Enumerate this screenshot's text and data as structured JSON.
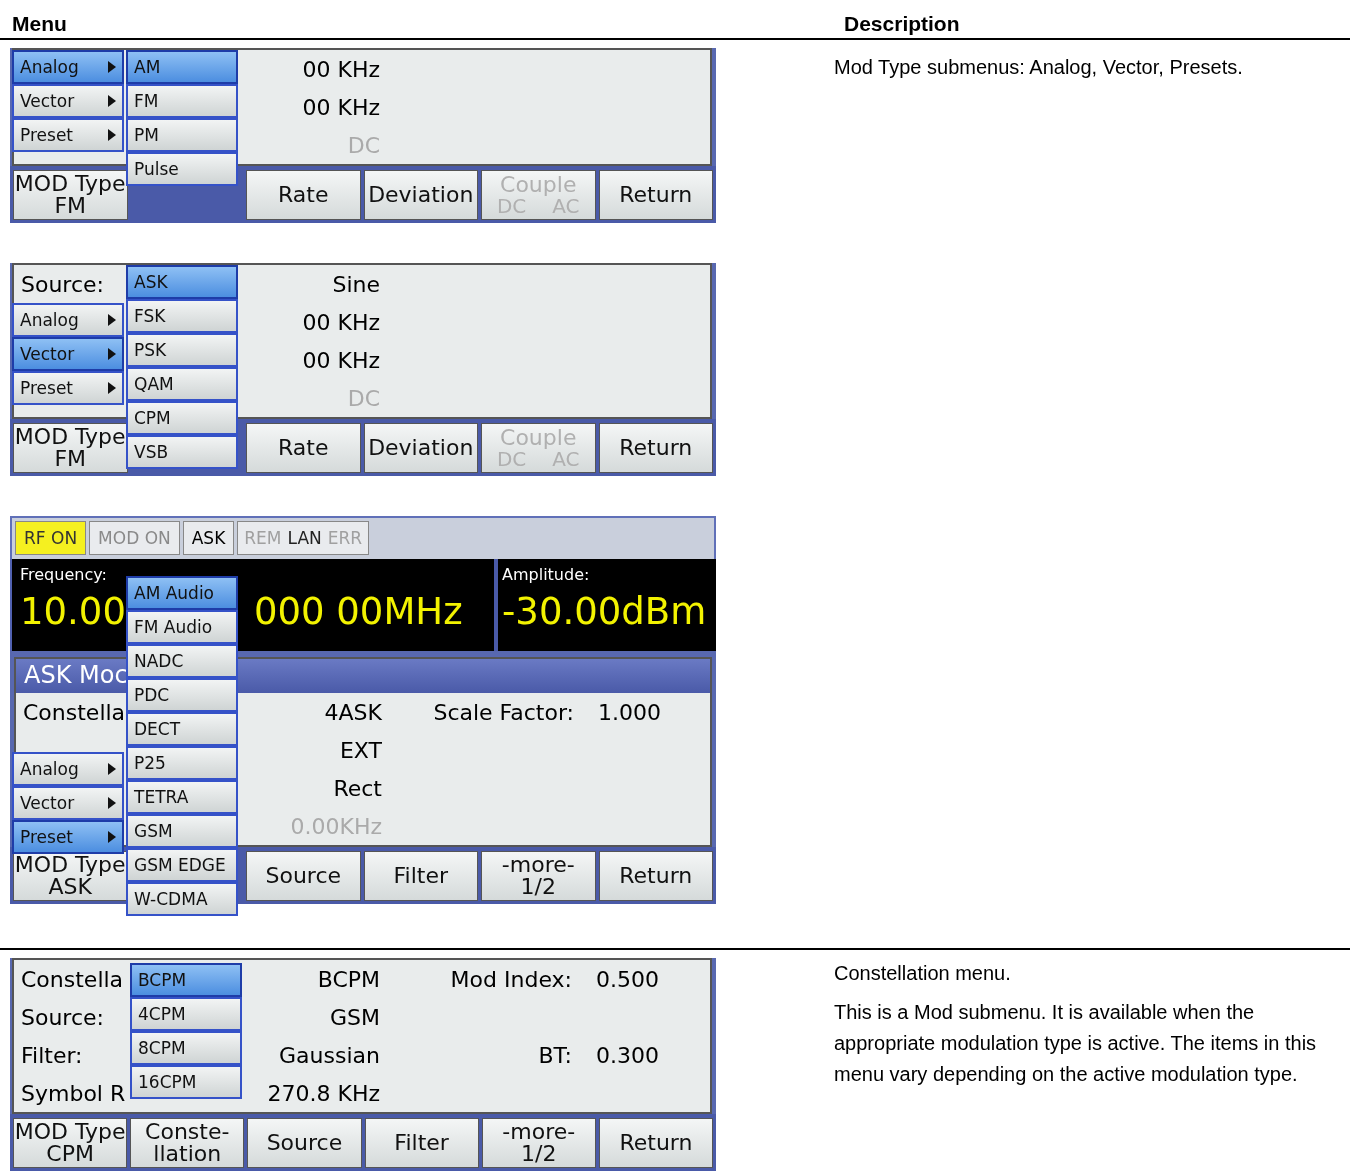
{
  "header": {
    "menu_heading": "Menu",
    "description_heading": "Description"
  },
  "sections": [
    {
      "screens": [
        {
          "panel": {
            "rows": [
              {
                "value": "00 KHz"
              },
              {
                "value": "00 KHz"
              },
              {
                "value": "DC",
                "disabled": true
              }
            ]
          },
          "menus": [
            {
              "kind": "main",
              "items": [
                {
                  "label": "Analog",
                  "selected": true
                },
                {
                  "label": "Vector",
                  "selected": false
                },
                {
                  "label": "Preset",
                  "selected": false
                }
              ]
            },
            {
              "kind": "sub",
              "items": [
                {
                  "label": "AM",
                  "selected": true
                },
                {
                  "label": "FM",
                  "selected": false
                },
                {
                  "label": "PM",
                  "selected": false
                },
                {
                  "label": "Pulse",
                  "selected": false
                }
              ]
            }
          ],
          "softkeys": [
            {
              "lines": [
                "MOD Type",
                "FM"
              ]
            },
            {
              "lines": [
                "Rate"
              ]
            },
            {
              "lines": [
                "Deviation"
              ]
            },
            {
              "lines": [
                "Couple"
              ],
              "options": [
                "DC",
                "AC"
              ],
              "disabled": true
            },
            {
              "lines": [
                "Return"
              ]
            }
          ]
        },
        {
          "panel": {
            "rows": [
              {
                "label": "Source:",
                "value": "Sine"
              },
              {
                "value": "00 KHz"
              },
              {
                "value": "00 KHz"
              },
              {
                "value": "DC",
                "disabled": true
              }
            ]
          },
          "menus": [
            {
              "kind": "main",
              "items": [
                {
                  "label": "Analog",
                  "selected": false
                },
                {
                  "label": "Vector",
                  "selected": true
                },
                {
                  "label": "Preset",
                  "selected": false
                }
              ]
            },
            {
              "kind": "sub",
              "items": [
                {
                  "label": "ASK",
                  "selected": true
                },
                {
                  "label": "FSK",
                  "selected": false
                },
                {
                  "label": "PSK",
                  "selected": false
                },
                {
                  "label": "QAM",
                  "selected": false
                },
                {
                  "label": "CPM",
                  "selected": false
                },
                {
                  "label": "VSB",
                  "selected": false
                }
              ]
            }
          ],
          "softkeys": [
            {
              "lines": [
                "MOD Type",
                "FM"
              ]
            },
            {
              "lines": [
                "Rate"
              ]
            },
            {
              "lines": [
                "Deviation"
              ]
            },
            {
              "lines": [
                "Couple"
              ],
              "options": [
                "DC",
                "AC"
              ],
              "disabled": true
            },
            {
              "lines": [
                "Return"
              ]
            }
          ]
        },
        {
          "status_bar": [
            {
              "kind": "highlight",
              "label": "RF ON"
            },
            {
              "kind": "dim",
              "label": "MOD ON"
            },
            {
              "kind": "plain",
              "label": "ASK"
            },
            {
              "kind": "indicators",
              "items": [
                {
                  "label": "REM",
                  "on": false
                },
                {
                  "label": "LAN",
                  "on": true
                },
                {
                  "label": "ERR",
                  "on": false
                }
              ]
            }
          ],
          "readout": {
            "frequency_label": "Frequency:",
            "frequency_parts": [
              "10.00",
              "000 00MHz"
            ],
            "amplitude_label": "Amplitude:",
            "amplitude": "-30.00dBm"
          },
          "panel": {
            "title": "ASK Moc",
            "rows": [
              {
                "label": "Constella",
                "value": "4ASK",
                "label_2": "Scale Factor:",
                "value_2": "1.000"
              },
              {
                "value": "EXT"
              },
              {
                "value": "Rect"
              },
              {
                "value": "0.00KHz",
                "disabled": true
              }
            ]
          },
          "menus": [
            {
              "kind": "main",
              "items": [
                {
                  "label": "Analog",
                  "selected": false
                },
                {
                  "label": "Vector",
                  "selected": false
                },
                {
                  "label": "Preset",
                  "selected": true
                }
              ]
            },
            {
              "kind": "sub",
              "items": [
                {
                  "label": "AM Audio",
                  "selected": true
                },
                {
                  "label": "FM Audio",
                  "selected": false
                },
                {
                  "label": "NADC",
                  "selected": false
                },
                {
                  "label": "PDC",
                  "selected": false
                },
                {
                  "label": "DECT",
                  "selected": false
                },
                {
                  "label": "P25",
                  "selected": false
                },
                {
                  "label": "TETRA",
                  "selected": false
                },
                {
                  "label": "GSM",
                  "selected": false
                },
                {
                  "label": "GSM EDGE",
                  "selected": false
                },
                {
                  "label": "W-CDMA",
                  "selected": false
                }
              ]
            }
          ],
          "softkeys": [
            {
              "lines": [
                "MOD Type",
                "ASK"
              ]
            },
            {
              "lines": [
                "Source"
              ]
            },
            {
              "lines": [
                "Filter"
              ]
            },
            {
              "lines": [
                "-more-",
                "1/2"
              ]
            },
            {
              "lines": [
                "Return"
              ]
            }
          ]
        }
      ],
      "description": [
        "Mod Type submenus: Analog, Vector, Presets."
      ]
    },
    {
      "screens": [
        {
          "panel": {
            "rows": [
              {
                "label": "Constella",
                "value": "BCPM",
                "label_2": "Mod Index:",
                "value_2": "0.500"
              },
              {
                "label": "Source:",
                "value": "GSM"
              },
              {
                "label": "Filter:",
                "value": "Gaussian",
                "label_2": "BT:",
                "value_2": "0.300"
              },
              {
                "label": "Symbol R",
                "value": "270.8 KHz"
              }
            ]
          },
          "menus": [
            {
              "kind": "sub",
              "items": [
                {
                  "label": "BCPM",
                  "selected": true
                },
                {
                  "label": "4CPM",
                  "selected": false
                },
                {
                  "label": "8CPM",
                  "selected": false
                },
                {
                  "label": "16CPM",
                  "selected": false
                }
              ]
            }
          ],
          "softkeys": [
            {
              "lines": [
                "MOD Type",
                "CPM"
              ]
            },
            {
              "lines": [
                "Conste-",
                "llation"
              ]
            },
            {
              "lines": [
                "Source"
              ]
            },
            {
              "lines": [
                "Filter"
              ]
            },
            {
              "lines": [
                "-more-",
                "1/2"
              ]
            },
            {
              "lines": [
                "Return"
              ]
            }
          ]
        }
      ],
      "description": [
        "Constellation menu.",
        "This is a Mod submenu.  It is available when the appropriate modulation type is active.  The items in this menu vary depending on the active modulation type."
      ]
    }
  ]
}
